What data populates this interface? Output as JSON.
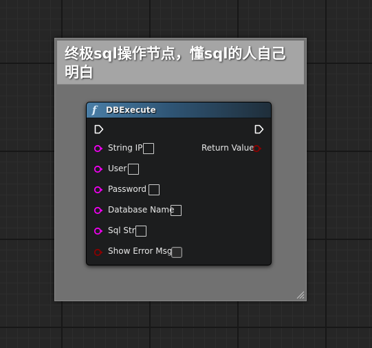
{
  "comment": {
    "text": "终极sql操作节点，懂sql的人自己明白",
    "header_color": "#a5a5a5",
    "body_color": "#717171"
  },
  "node": {
    "type_icon": "function-icon",
    "type_glyph": "f",
    "title": "DBExecute",
    "header_color": "#4a7ea6",
    "inputs": [
      {
        "label": "String IP",
        "pin_color": "#f200f2",
        "value": ""
      },
      {
        "label": "User",
        "pin_color": "#f200f2",
        "value": ""
      },
      {
        "label": "Password",
        "pin_color": "#f200f2",
        "value": ""
      },
      {
        "label": "Database Name",
        "pin_color": "#f200f2",
        "value": ""
      },
      {
        "label": "Sql Str",
        "pin_color": "#f200f2",
        "value": ""
      },
      {
        "label": "Show Error Msg",
        "pin_color": "#8c0000",
        "checked": false
      }
    ],
    "outputs": [
      {
        "label": "Return Value",
        "pin_color": "#8c0000"
      }
    ]
  }
}
